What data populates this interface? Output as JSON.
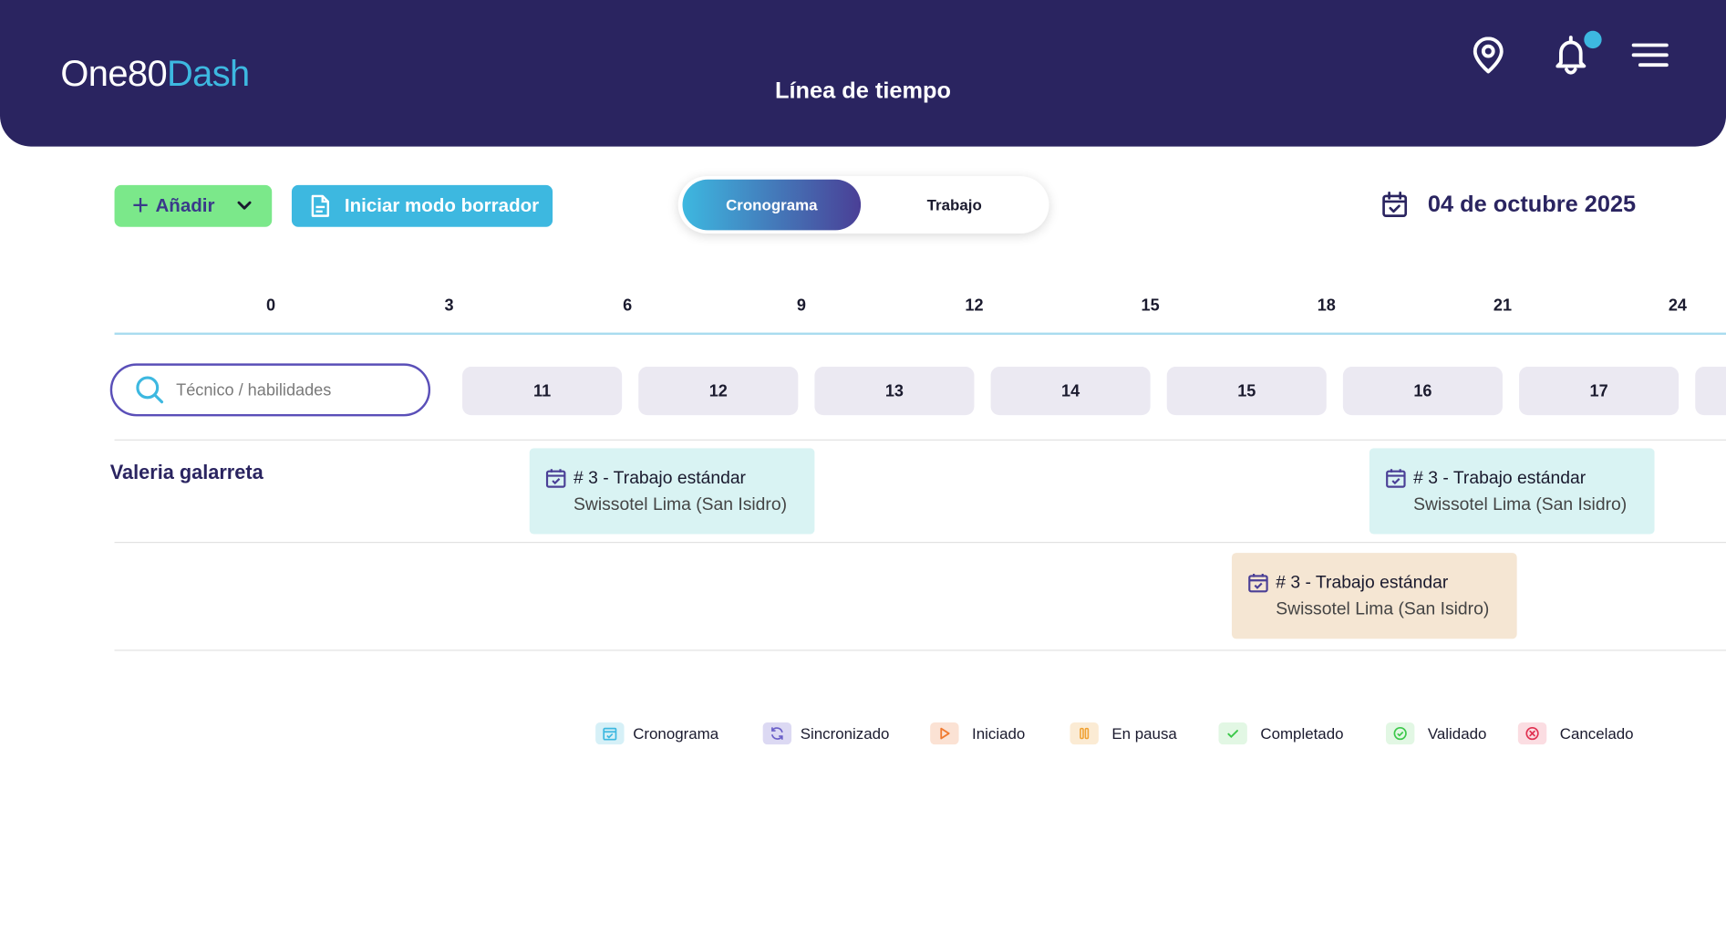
{
  "header": {
    "logo_main": "One80",
    "logo_accent": "Dash",
    "title": "Línea de tiempo",
    "icons": [
      "location-pin-icon",
      "bell-icon",
      "menu-icon"
    ],
    "brand_color": "#2a2460",
    "accent_color": "#3db8e0"
  },
  "toolbar": {
    "add_label": "Añadir",
    "draft_label": "Iniciar modo borrador",
    "toggle": {
      "active": "Cronograma",
      "inactive": "Trabajo"
    },
    "date": "04 de octubre 2025"
  },
  "timeline": {
    "hours": [
      "0",
      "3",
      "6",
      "9",
      "12",
      "15",
      "18",
      "21",
      "24"
    ],
    "days": [
      "11",
      "12",
      "13",
      "14",
      "15",
      "16",
      "17"
    ],
    "search_placeholder": "Técnico / habilidades"
  },
  "technicians": [
    {
      "name": "Valeria galarreta",
      "tasks": [
        {
          "title": "# 3 - Trabajo estándar",
          "location": "Swissotel Lima (San Isidro)",
          "status": "Cronograma"
        },
        {
          "title": "# 3 - Trabajo estándar",
          "location": "Swissotel Lima (San Isidro)",
          "status": "Cronograma"
        },
        {
          "title": "# 3 - Trabajo estándar",
          "location": "Swissotel Lima (San Isidro)",
          "status": "En pausa"
        }
      ]
    }
  ],
  "legend": [
    {
      "label": "Cronograma",
      "icon": "calendar-check-icon",
      "color": "#3db8e0"
    },
    {
      "label": "Sincronizado",
      "icon": "sync-icon",
      "color": "#6a5fc8"
    },
    {
      "label": "Iniciado",
      "icon": "play-icon",
      "color": "#f07a30"
    },
    {
      "label": "En pausa",
      "icon": "pause-icon",
      "color": "#f0a030"
    },
    {
      "label": "Completado",
      "icon": "check-icon",
      "color": "#3cc84a"
    },
    {
      "label": "Validado",
      "icon": "check-circle-icon",
      "color": "#3cc84a"
    },
    {
      "label": "Cancelado",
      "icon": "x-circle-icon",
      "color": "#e03050"
    }
  ]
}
